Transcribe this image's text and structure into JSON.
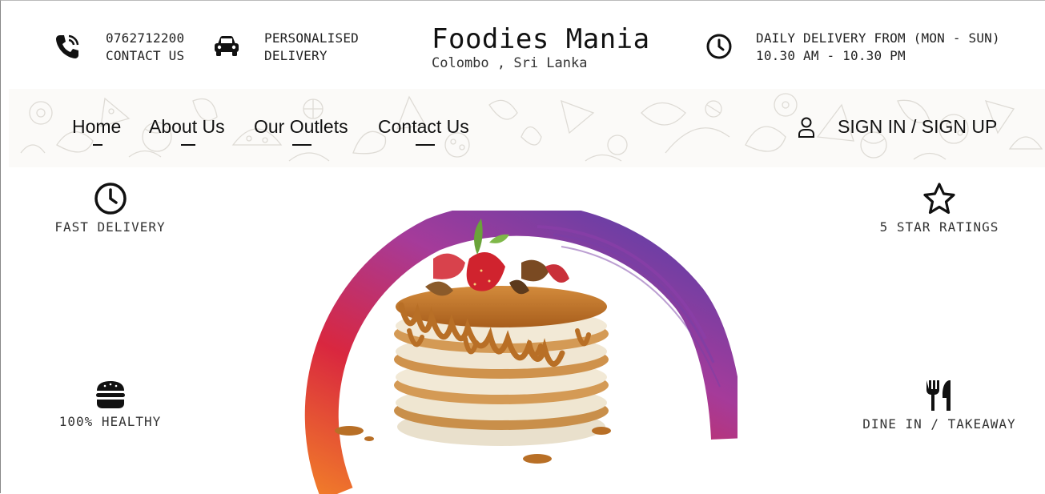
{
  "topbar": {
    "phone": {
      "line1": "0762712200",
      "line2": "CONTACT US",
      "icon": "phone-icon"
    },
    "delivery": {
      "line1": "PERSONALISED",
      "line2": "DELIVERY",
      "icon": "car-icon"
    },
    "brand": {
      "title": "Foodies Mania",
      "subtitle": "Colombo , Sri Lanka"
    },
    "hours": {
      "line1": "DAILY DELIVERY FROM (MON - SUN)",
      "line2": "10.30 AM - 10.30 PM",
      "icon": "clock-icon"
    }
  },
  "nav": {
    "items": [
      {
        "label": "Home"
      },
      {
        "label": "About Us"
      },
      {
        "label": "Our Outlets"
      },
      {
        "label": "Contact Us"
      }
    ],
    "signin": {
      "label": "SIGN IN / SIGN UP",
      "icon": "user-icon"
    }
  },
  "features": {
    "fast": {
      "label": "FAST DELIVERY",
      "icon": "clock-icon"
    },
    "stars": {
      "label": "5 STAR RATINGS",
      "icon": "star-icon"
    },
    "healthy": {
      "label": "100% HEALTHY",
      "icon": "burger-icon"
    },
    "dine": {
      "label": "DINE IN / TAKEAWAY",
      "icon": "fork-knife-icon"
    }
  },
  "hero": {
    "image": "pancake-stack-image"
  },
  "colors": {
    "gradient_top": "#7b3fa3",
    "gradient_mid": "#d9273f",
    "gradient_bottom": "#f07a2a",
    "syrup": "#c97a2b"
  }
}
